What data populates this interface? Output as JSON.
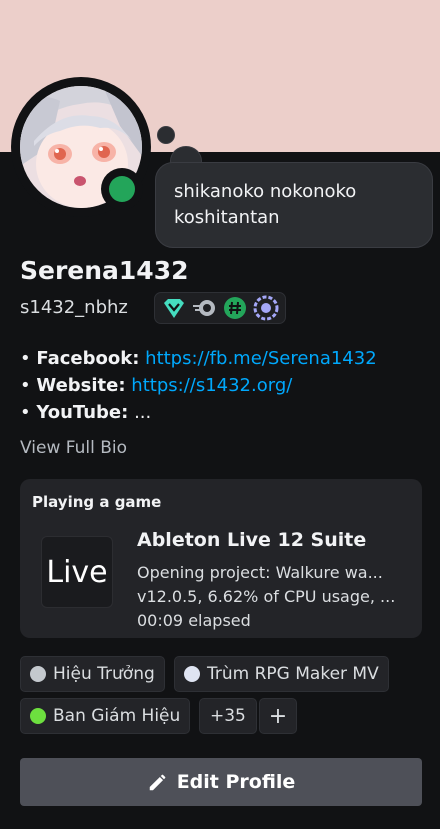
{
  "profile": {
    "display_name": "Serena1432",
    "username": "s1432_nbhz",
    "custom_status": "shikanoko nokonoko koshitantan",
    "status_color": "#23a55a",
    "banner_color": "#eccfca"
  },
  "badges": [
    {
      "icon": "hypesquad-balance-icon",
      "color": "#45ddc0"
    },
    {
      "icon": "nitro-icon",
      "color": "#b5bac1"
    },
    {
      "icon": "hashtag-icon",
      "color": "#23a55a"
    },
    {
      "icon": "laurel-icon",
      "color": "#a4a7f7"
    }
  ],
  "bio": {
    "lines": [
      {
        "bullet": "•",
        "label": "Facebook:",
        "value": "https://fb.me/Serena1432"
      },
      {
        "bullet": "•",
        "label": "Website:",
        "value": "https://s1432.org/"
      },
      {
        "bullet": "•",
        "label": "YouTube:",
        "value": "..."
      }
    ],
    "view_full_bio": "View Full Bio"
  },
  "activity": {
    "header": "Playing a game",
    "icon_text": "Live",
    "title": "Ableton Live 12 Suite",
    "details": "Opening project: Walkure wa...",
    "state": "v12.0.5, 6.62% of CPU usage, ...",
    "elapsed": "00:09 elapsed"
  },
  "roles": [
    {
      "name": "Hiệu Trưởng",
      "color": "#c4c9ce"
    },
    {
      "name": "Trùm RPG Maker MV",
      "color": "#dfe4f2"
    },
    {
      "name": "Ban Giám Hiệu",
      "color": "#6ddf3f"
    }
  ],
  "roles_more": "+35",
  "roles_add": "+",
  "edit_button": "Edit Profile"
}
